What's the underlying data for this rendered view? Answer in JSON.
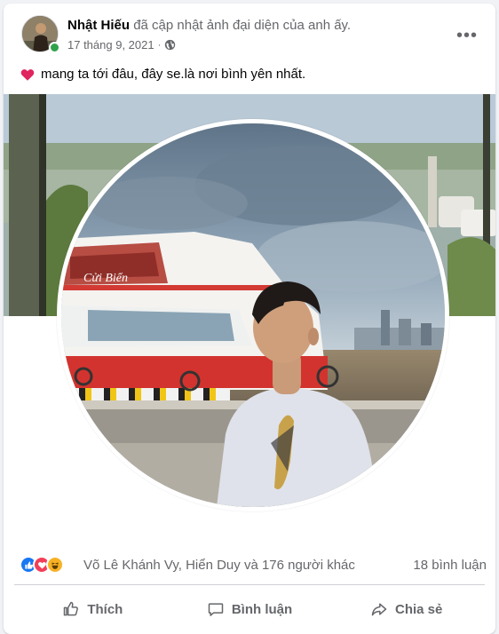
{
  "post": {
    "author": "Nhật Hiếu",
    "action_text": "đã cập nhật ảnh đại diện của anh ấy.",
    "date": "17 tháng 9, 2021",
    "separator": "·",
    "privacy_icon": "globe-icon",
    "more_icon": "•••",
    "caption_icon": "heart-icon",
    "caption": "mang ta tới đâu, đây se.là nơi bình yên nhất.",
    "boat_sign": "Cửi Biển"
  },
  "reactions": {
    "icons": [
      "like-icon",
      "love-icon",
      "haha-icon"
    ],
    "names": "Võ Lê Khánh Vy, Hiển Duy và 176 người khác",
    "comments": "18 bình luận"
  },
  "actions": {
    "like_label": "Thích",
    "comment_label": "Bình luận",
    "share_label": "Chia sẻ"
  },
  "colors": {
    "accent": "#1877f2",
    "online": "#31a24c",
    "love": "#f33e58",
    "haha": "#f7b125",
    "secondary_text": "#65676b"
  }
}
